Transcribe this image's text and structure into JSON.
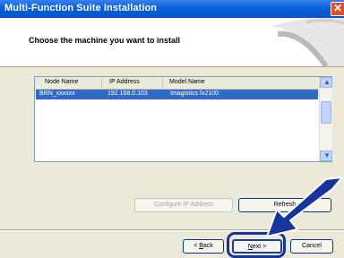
{
  "window": {
    "title": "Multi-Function Suite Installation"
  },
  "header": {
    "heading": "Choose the machine you want to install"
  },
  "list": {
    "columns": [
      "Node Name",
      "IP Address",
      "Model Name"
    ],
    "rows": [
      {
        "node": "BRN_xxxxxx",
        "ip": "192.168.0.103",
        "model": "Imagistics fx2100"
      }
    ]
  },
  "buttons": {
    "configure_ip": "Configure IP Address",
    "refresh": "Refresh",
    "back_prefix": "< ",
    "back_key": "B",
    "back_rest": "ack",
    "next_key": "N",
    "next_rest": "ext >",
    "cancel": "Cancel"
  },
  "colors": {
    "titlebar": "#0a5fd8",
    "selection": "#316ac5",
    "callout": "#16349a"
  }
}
